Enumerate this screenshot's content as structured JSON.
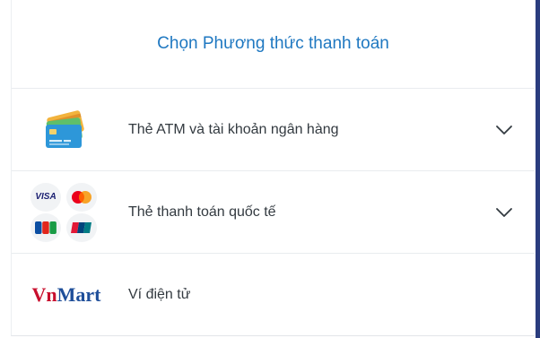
{
  "header": {
    "title": "Chọn Phương thức thanh toán"
  },
  "methods": [
    {
      "label": "Thẻ ATM và tài khoản ngân hàng",
      "icon": "bank-cards-icon",
      "expandable": true
    },
    {
      "label": "Thẻ thanh toán quốc tế",
      "icon": "international-cards-icon",
      "expandable": true,
      "brand_logos": {
        "visa": "VISA"
      }
    },
    {
      "label": "Ví điện tử",
      "icon": "vnmart-logo",
      "expandable": false,
      "logo": {
        "part1": "Vn",
        "part2": "Mart"
      }
    }
  ],
  "colors": {
    "title": "#1f78c1",
    "text": "#333a40",
    "chevron": "#333a40",
    "vnmart_red": "#c8102e",
    "vnmart_blue": "#1f4f9a",
    "right_bar": "#2a3c7e"
  }
}
